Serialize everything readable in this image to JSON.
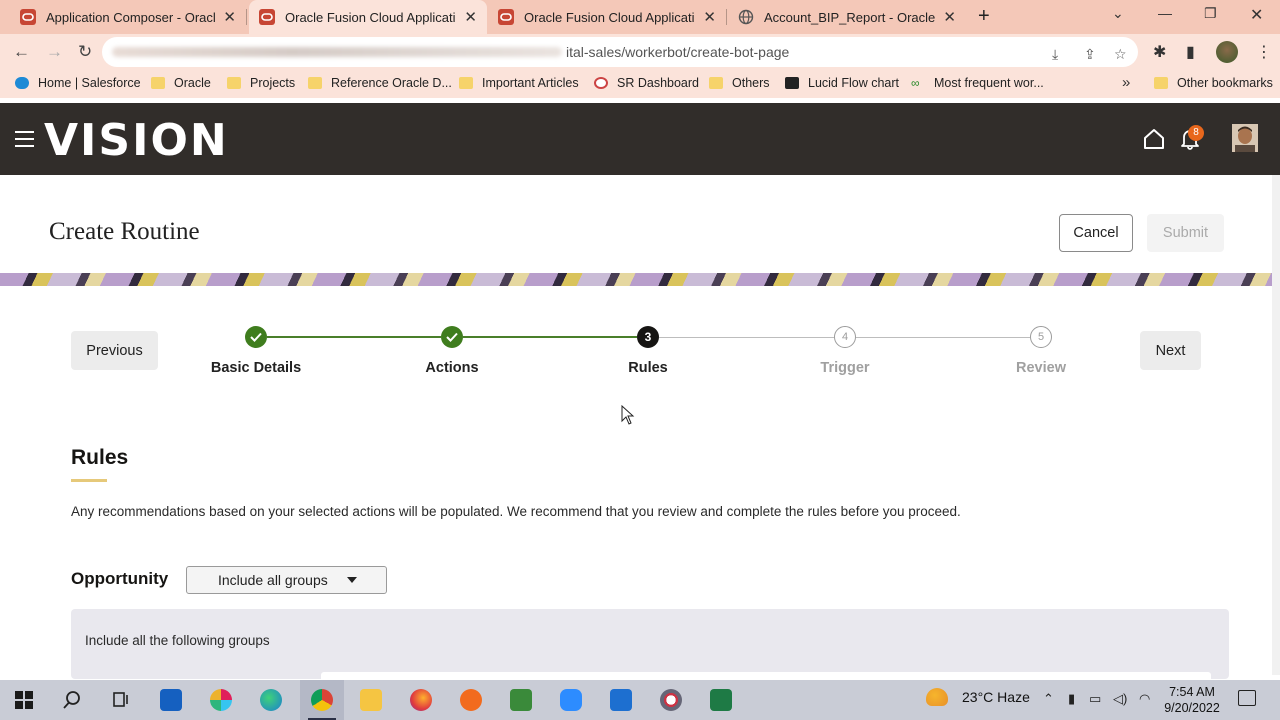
{
  "browser": {
    "tabs": [
      {
        "title": "Application Composer - Oracle Fusion",
        "active": false
      },
      {
        "title": "Oracle Fusion Cloud Applications",
        "active": true
      },
      {
        "title": "Oracle Fusion Cloud Applications",
        "active": false
      },
      {
        "title": "Account_BIP_Report - Oracle Analytics",
        "active": false
      }
    ],
    "url_visible": "ital-sales/workerbot/create-bot-page",
    "bookmarks": [
      {
        "label": "Home | Salesforce",
        "icon": "salesforce-cloud-icon"
      },
      {
        "label": "Oracle",
        "icon": "folder-icon"
      },
      {
        "label": "Projects",
        "icon": "folder-icon"
      },
      {
        "label": "Reference Oracle D...",
        "icon": "folder-icon"
      },
      {
        "label": "Important Articles",
        "icon": "folder-icon"
      },
      {
        "label": "SR Dashboard",
        "icon": "sr-icon"
      },
      {
        "label": "Others",
        "icon": "folder-icon"
      },
      {
        "label": "Lucid Flow chart",
        "icon": "lucid-icon"
      },
      {
        "label": "Most frequent wor...",
        "icon": "mfw-icon"
      }
    ],
    "other_bookmarks": "Other bookmarks"
  },
  "app": {
    "logo": "VISION",
    "notification_count": "8"
  },
  "page": {
    "title": "Create Routine",
    "cancel": "Cancel",
    "submit": "Submit",
    "previous": "Previous",
    "next": "Next",
    "steps": [
      {
        "number": "1",
        "label": "Basic Details",
        "state": "done"
      },
      {
        "number": "2",
        "label": "Actions",
        "state": "done"
      },
      {
        "number": "3",
        "label": "Rules",
        "state": "current"
      },
      {
        "number": "4",
        "label": "Trigger",
        "state": "todo"
      },
      {
        "number": "5",
        "label": "Review",
        "state": "todo"
      }
    ],
    "section_title": "Rules",
    "description": "Any recommendations based on your selected actions will be populated. We recommend that you review and complete the rules before you proceed.",
    "opportunity_label": "Opportunity",
    "group_select_value": "Include all groups",
    "group_panel_text": "Include all the following groups"
  },
  "taskbar": {
    "weather": "23°C  Haze",
    "time": "7:54 AM",
    "date": "9/20/2022"
  },
  "colors": {
    "header_bg": "#312d2a",
    "step_done": "#3f7d1e",
    "step_current": "#161513",
    "accent_underline": "#e6c97a"
  }
}
